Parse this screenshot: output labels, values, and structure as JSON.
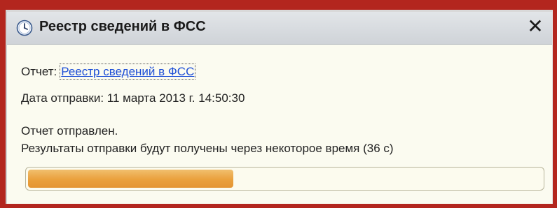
{
  "window": {
    "title": "Реестр сведений в ФСС",
    "close_symbol": "✕",
    "icon": "clock-icon"
  },
  "report": {
    "label": "Отчет:",
    "link_text": "Реестр сведений в ФСС"
  },
  "date": {
    "text": "Дата отправки: 11 марта 2013 г. 14:50:30"
  },
  "status": {
    "line1": "Отчет отправлен.",
    "line2": "Результаты отправки будут получены через некоторое время (36 с)"
  },
  "progress": {
    "value": 0.4
  },
  "colors": {
    "frame": "#b3261e",
    "link": "#1e4fd6",
    "progress_fill": "#eaa03c"
  }
}
